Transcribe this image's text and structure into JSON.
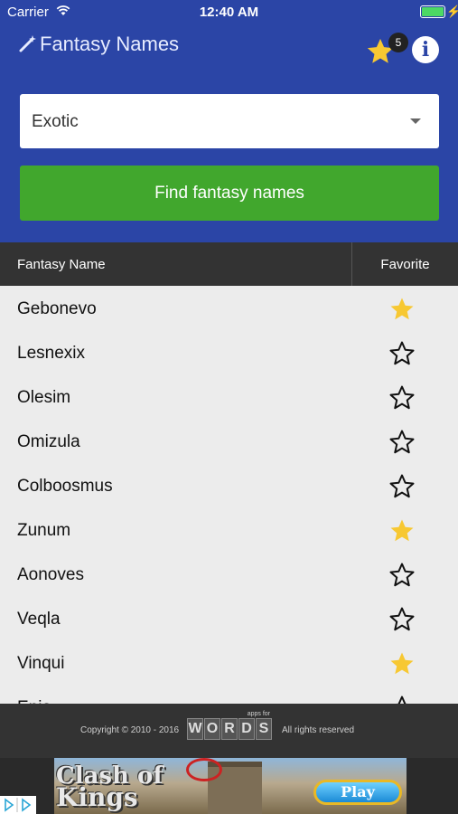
{
  "status_bar": {
    "carrier": "Carrier",
    "time": "12:40 AM"
  },
  "app": {
    "title": "Fantasy Names",
    "favorites_count": "5",
    "info_label": "i"
  },
  "filter": {
    "selected": "Exotic"
  },
  "find_button_label": "Find fantasy names",
  "table": {
    "col_name": "Fantasy Name",
    "col_favorite": "Favorite",
    "rows": [
      {
        "name": "Gebonevo",
        "favorite": true
      },
      {
        "name": "Lesnexix",
        "favorite": false
      },
      {
        "name": "Olesim",
        "favorite": false
      },
      {
        "name": "Omizula",
        "favorite": false
      },
      {
        "name": "Colboosmus",
        "favorite": false
      },
      {
        "name": "Zunum",
        "favorite": true
      },
      {
        "name": "Aonoves",
        "favorite": false
      },
      {
        "name": "Veqla",
        "favorite": false
      },
      {
        "name": "Vinqui",
        "favorite": true
      },
      {
        "name": "Enja",
        "favorite": false
      }
    ]
  },
  "footer": {
    "copyright": "Copyright © 2010 - 2016",
    "logo_tag": "apps for",
    "logo_letters": [
      "W",
      "O",
      "R",
      "D",
      "S"
    ],
    "rights": "All rights reserved"
  },
  "ad": {
    "title_line1": "Clash of",
    "title_line2": "Kings",
    "cta": "Play"
  },
  "colors": {
    "header": "#2b45a6",
    "find_button": "#41a72d",
    "star_filled": "#f7c832",
    "footer": "#333333"
  }
}
